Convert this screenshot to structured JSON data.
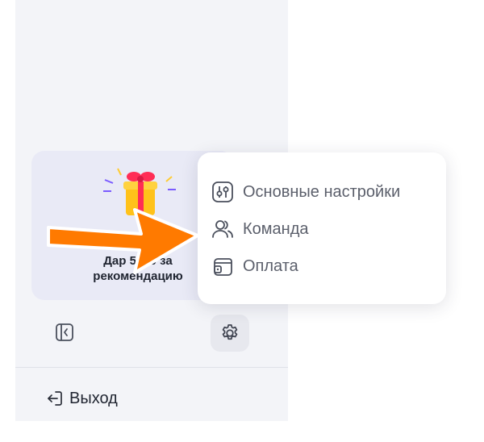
{
  "sidebar": {
    "promo": {
      "line1": "Дар  5000 за",
      "line2": "рекомендацию"
    },
    "collapse_icon": "sidebar-collapse-icon",
    "settings_icon": "gear-icon",
    "logout_label": "Выход"
  },
  "settings_menu": {
    "items": [
      {
        "label": "Основные настройки",
        "icon": "sliders-icon"
      },
      {
        "label": "Команда",
        "icon": "users-icon"
      },
      {
        "label": "Оплата",
        "icon": "wallet-icon"
      }
    ]
  },
  "colors": {
    "sidebar_bg": "#f3f4f8",
    "promo_bg": "#e9eaf6",
    "arrow": "#ff7a00",
    "menu_text": "#5b5f6b"
  }
}
